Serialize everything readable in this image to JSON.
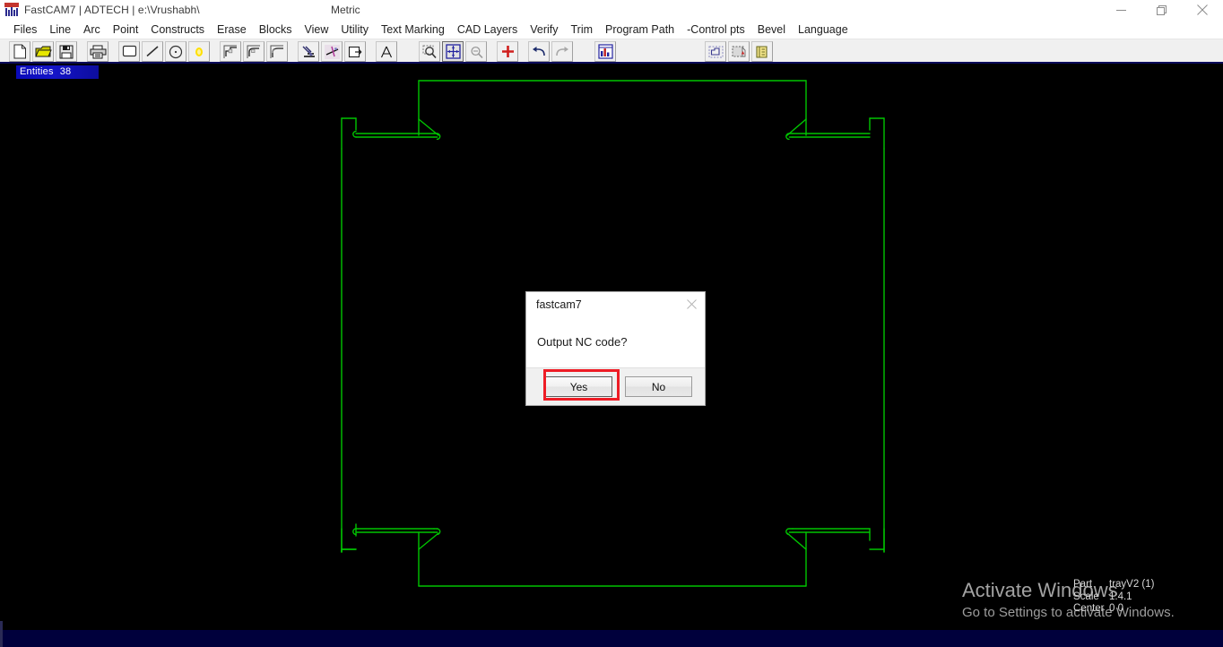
{
  "window": {
    "title": "FastCAM7  |  ADTECH  |  e:\\Vrushabh\\",
    "units": "Metric",
    "logo_icon": "fastcam-logo-icon",
    "controls": [
      {
        "name": "minimize-button",
        "icon": "minimize-icon"
      },
      {
        "name": "maximize-button",
        "icon": "restore-icon"
      },
      {
        "name": "close-button",
        "icon": "close-icon"
      }
    ]
  },
  "menubar": {
    "items": [
      {
        "label": "Files"
      },
      {
        "label": "Line"
      },
      {
        "label": "Arc"
      },
      {
        "label": "Point"
      },
      {
        "label": "Constructs"
      },
      {
        "label": "Erase"
      },
      {
        "label": "Blocks"
      },
      {
        "label": "View"
      },
      {
        "label": "Utility"
      },
      {
        "label": "Text Marking"
      },
      {
        "label": "CAD Layers"
      },
      {
        "label": "Verify"
      },
      {
        "label": "Trim"
      },
      {
        "label": "Program Path"
      },
      {
        "label": "-Control pts"
      },
      {
        "label": "Bevel"
      },
      {
        "label": "Language"
      }
    ]
  },
  "toolbar": {
    "buttons": [
      {
        "name": "new-file-button",
        "icon": "new-document-icon",
        "tip": "New"
      },
      {
        "name": "open-file-button",
        "icon": "open-folder-icon",
        "tip": "Open"
      },
      {
        "name": "save-file-button",
        "icon": "floppy-disk-icon",
        "tip": "Save"
      },
      {
        "name": "print-button",
        "icon": "printer-icon",
        "tip": "Print"
      },
      {
        "name": "rectangle-button",
        "icon": "rectangle-icon",
        "tip": "Rectangle"
      },
      {
        "name": "line-button",
        "icon": "line-icon",
        "tip": "Line"
      },
      {
        "name": "circle-button",
        "icon": "circle-icon",
        "tip": "Circle"
      },
      {
        "name": "point-button",
        "icon": "point-icon",
        "tip": "Point"
      },
      {
        "name": "chamfer-button",
        "icon": "chamfer-icon",
        "tip": "Chamfer"
      },
      {
        "name": "fillet-button",
        "icon": "fillet-icon",
        "tip": "Fillet"
      },
      {
        "name": "arc-trim-button",
        "icon": "arc-trim-icon",
        "tip": "Arc Trim"
      },
      {
        "name": "pierce-button",
        "icon": "pierce-point-icon",
        "tip": "Pierce point"
      },
      {
        "name": "cut-path-button",
        "icon": "cut-path-icon",
        "tip": "Cut path"
      },
      {
        "name": "lead-in-button",
        "icon": "lead-in-icon",
        "tip": "Lead in"
      },
      {
        "name": "text-button",
        "icon": "text-A-icon",
        "tip": "Text"
      },
      {
        "name": "zoom-window-button",
        "icon": "zoom-window-icon",
        "tip": "Zoom window"
      },
      {
        "name": "zoom-fit-button",
        "icon": "zoom-fit-icon",
        "tip": "Zoom all",
        "active": true
      },
      {
        "name": "zoom-previous-button",
        "icon": "zoom-previous-icon",
        "tip": "Zoom previous"
      },
      {
        "name": "add-entity-button",
        "icon": "red-plus-icon",
        "tip": "Add"
      },
      {
        "name": "undo-button",
        "icon": "undo-arrow-icon",
        "tip": "Undo"
      },
      {
        "name": "redo-button",
        "icon": "redo-arrow-icon",
        "tip": "Redo"
      },
      {
        "name": "nc-code-button",
        "icon": "nc-code-icon",
        "tip": "NC code"
      },
      {
        "name": "nest-part-button",
        "icon": "nest-part-icon",
        "tip": "Nest part"
      },
      {
        "name": "plate-button",
        "icon": "plate-icon",
        "tip": "Plate"
      },
      {
        "name": "notes-button",
        "icon": "notes-icon",
        "tip": "Notes"
      }
    ]
  },
  "status": {
    "entities_label": "Entities",
    "entities_count": "38",
    "entities_bg": "#0000b4"
  },
  "part_info": {
    "rows": [
      {
        "label": "Part",
        "value": "trayV2 (1)"
      },
      {
        "label": "Scale",
        "value": "1:4.1"
      },
      {
        "label": "Center",
        "value": "0 0"
      }
    ]
  },
  "watermark": {
    "line1": "Activate Windows",
    "line2": "Go to Settings to activate Windows."
  },
  "canvas": {
    "stroke_color": "#00c800",
    "background": "#000000"
  },
  "dialog": {
    "title": "fastcam7",
    "message": "Output NC code?",
    "close_icon": "close-icon",
    "buttons": [
      {
        "name": "yes-button",
        "label": "Yes",
        "focused": true
      },
      {
        "name": "no-button",
        "label": "No",
        "focused": false
      }
    ],
    "highlight_color": "#ee1c25"
  }
}
